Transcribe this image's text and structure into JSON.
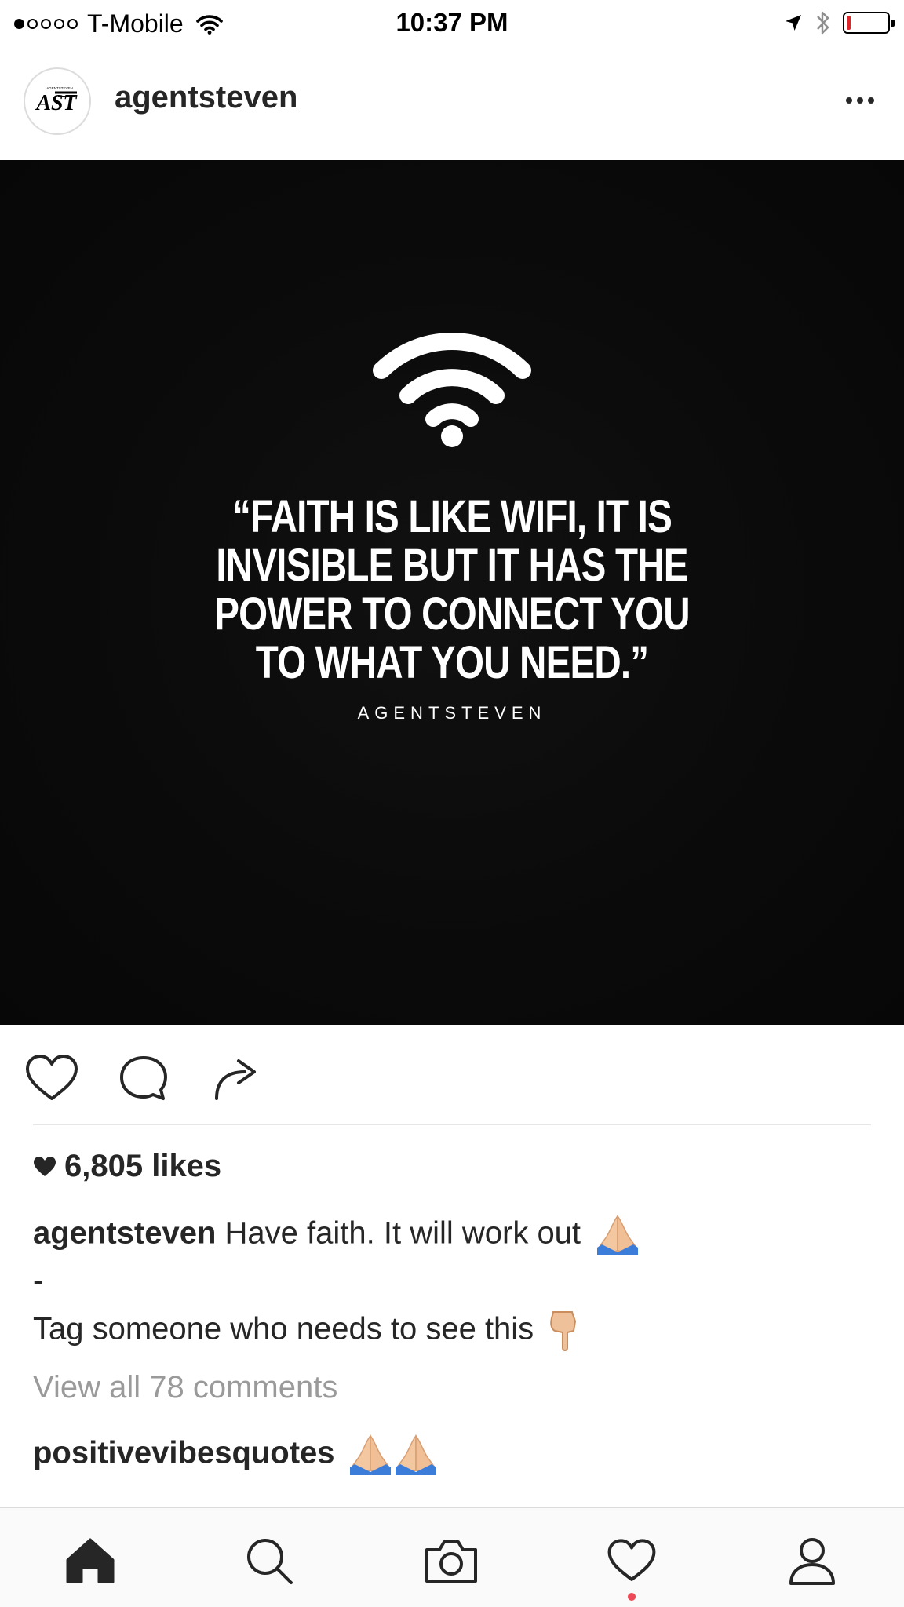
{
  "status_bar": {
    "carrier": "T-Mobile",
    "time": "10:37 PM",
    "signal_bars_filled": 1,
    "signal_bars_total": 5,
    "battery_level": 0.1,
    "icons": [
      "wifi-icon",
      "location-arrow-icon",
      "bluetooth-icon",
      "battery-icon"
    ]
  },
  "header": {
    "username": "agentsteven",
    "avatar_text": "AST",
    "avatar_subtext": "AGENTSTEVEN",
    "more_icon": "more-dots-icon"
  },
  "post_image": {
    "quote": "“FAITH IS LIKE WIFI, IT IS INVISIBLE BUT IT HAS THE POWER TO CONNECT YOU TO WHAT YOU NEED.”",
    "author": "AGENTSTEVEN",
    "icon": "wifi-icon",
    "background_color": "#0a0a0a"
  },
  "actions": {
    "like_icon": "heart-outline-icon",
    "comment_icon": "comment-bubble-icon",
    "share_icon": "share-arrow-icon"
  },
  "likes": {
    "text": "6,805 likes",
    "icon": "heart-filled-icon"
  },
  "caption": {
    "username": "agentsteven",
    "text": "Have faith. It will work out",
    "emoji": "folded-hands-emoji",
    "line2": "-",
    "line3": "Tag someone who needs to see this",
    "line3_emoji": "pointing-down-emoji"
  },
  "comments": {
    "view_all": "View all 78 comments",
    "first_comment_user": "positivevibesquotes",
    "first_comment_emoji": "folded-hands-emoji-x2"
  },
  "tab_bar": {
    "tabs": [
      "home-icon",
      "search-icon",
      "camera-icon",
      "activity-heart-icon",
      "profile-icon"
    ],
    "notification_color": "#ed4956"
  }
}
